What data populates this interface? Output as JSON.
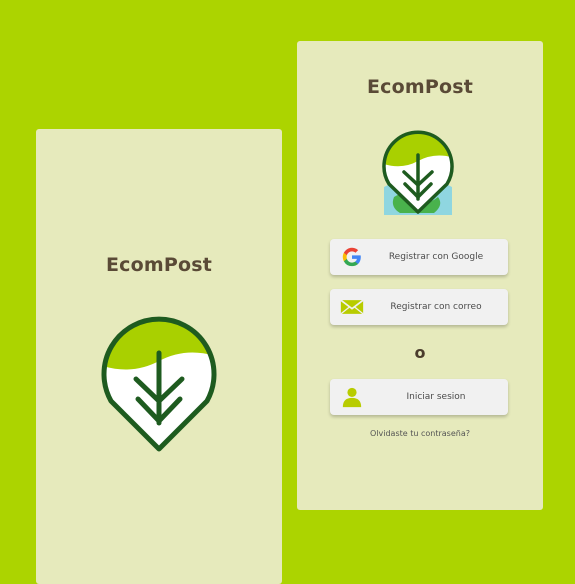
{
  "colors": {
    "background": "#acd400",
    "card": "#e6eabc",
    "logo_green": "#1e5b1f",
    "logo_lime": "#a9d000",
    "title_brown": "#5a4a36",
    "button": "#f1f1f1"
  },
  "splash": {
    "title": "EcomPost"
  },
  "login": {
    "title": "EcomPost",
    "google_button": {
      "label": "Registrar con Google",
      "icon": "google-icon"
    },
    "email_button": {
      "label": "Registrar con correo",
      "icon": "envelope-icon"
    },
    "separator": "o",
    "signin_button": {
      "label": "Iniciar sesion",
      "icon": "user-icon"
    },
    "forgot_link": "Olvidaste tu contraseña?"
  }
}
